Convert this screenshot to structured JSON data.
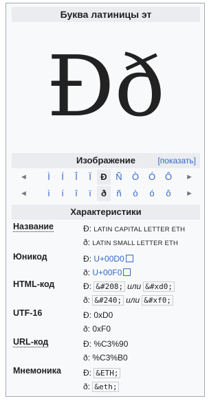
{
  "title": "Буква латиницы эт",
  "glyph": "Ðð",
  "image_section": {
    "title": "Изображение",
    "show_link": "[показать]"
  },
  "nav": {
    "left_arrow": "◄",
    "right_arrow": "►",
    "upper": [
      "Ì",
      "Í",
      "Î",
      "Ï",
      "Ð",
      "Ñ",
      "Ò",
      "Ó",
      "Ô"
    ],
    "lower": [
      "ì",
      "í",
      "î",
      "ï",
      "ð",
      "ñ",
      "ò",
      "ó",
      "ô"
    ],
    "current_index": 4
  },
  "characteristics": {
    "title": "Характеристики",
    "name": {
      "label": "Название",
      "upper": "Ð:",
      "upper_val": "LATIN CAPITAL LETTER ETH",
      "lower": "ð:",
      "lower_val": "LATIN SMALL LETTER ETH"
    },
    "unicode": {
      "label": "Юникод",
      "upper": "Ð:",
      "upper_val": "U+00D0",
      "lower": "ð:",
      "lower_val": "U+00F0"
    },
    "html": {
      "label": "HTML-код",
      "upper": "Ð:",
      "upper_a": "&#208;",
      "upper_b": "&#xd0;",
      "lower": "ð:",
      "lower_a": "&#240;",
      "lower_b": "&#xf0;",
      "or": "или"
    },
    "utf16": {
      "label": "UTF-16",
      "upper": "Ð:",
      "upper_val": "0xD0",
      "lower": "ð:",
      "lower_val": "0xF0"
    },
    "url": {
      "label": "URL-код",
      "upper": "Ð:",
      "upper_val": "%C3%90",
      "lower": "ð:",
      "lower_val": "%C3%B0"
    },
    "mnemonic": {
      "label": "Мнемоника",
      "upper": "Ð:",
      "upper_val": "&ETH;",
      "lower": "ð:",
      "lower_val": "&eth;"
    }
  },
  "colors": {
    "link": "#3366cc",
    "header_bg": "#eaecf0",
    "frame_bg": "#f8f9fa"
  }
}
